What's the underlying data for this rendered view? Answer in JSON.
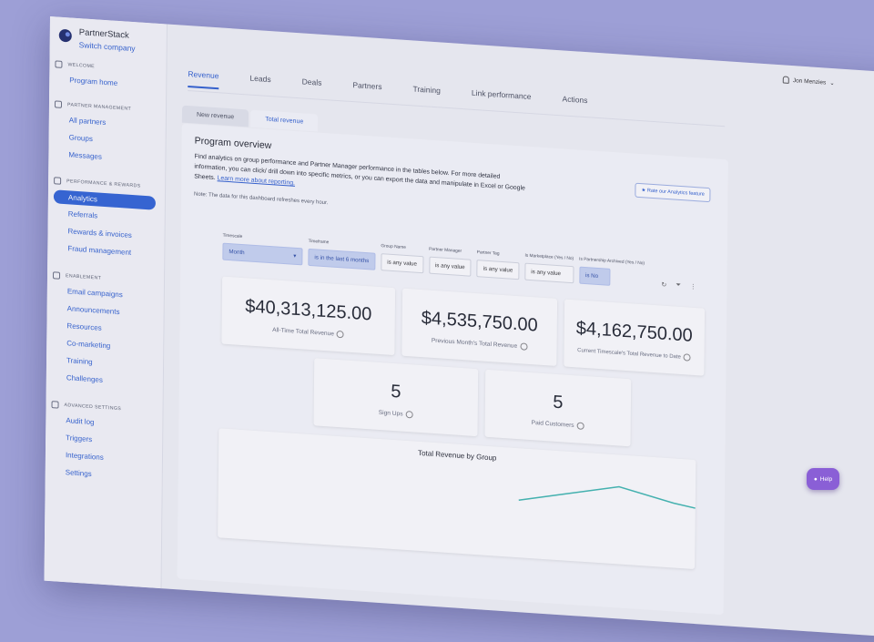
{
  "brand": {
    "name": "PartnerStack",
    "switch_label": "Switch company"
  },
  "user": {
    "name": "Jon Menzies"
  },
  "sidebar": {
    "sections": [
      {
        "title": "WELCOME",
        "items": [
          "Program home"
        ]
      },
      {
        "title": "PARTNER MANAGEMENT",
        "items": [
          "All partners",
          "Groups",
          "Messages"
        ]
      },
      {
        "title": "PERFORMANCE & REWARDS",
        "items": [
          "Analytics",
          "Referrals",
          "Rewards & invoices",
          "Fraud management"
        ]
      },
      {
        "title": "ENABLEMENT",
        "items": [
          "Email campaigns",
          "Announcements",
          "Resources",
          "Co-marketing",
          "Training",
          "Challenges"
        ]
      },
      {
        "title": "ADVANCED SETTINGS",
        "items": [
          "Audit log",
          "Triggers",
          "Integrations",
          "Settings"
        ]
      }
    ],
    "active_item": "Analytics"
  },
  "tabs": [
    "Revenue",
    "Leads",
    "Deals",
    "Partners",
    "Training",
    "Link performance",
    "Actions"
  ],
  "active_tab": "Revenue",
  "subtabs": [
    "New revenue",
    "Total revenue"
  ],
  "active_subtab": "Total revenue",
  "panel": {
    "title": "Program overview",
    "desc": "Find analytics on group performance and Partner Manager performance in the tables below. For more detailed information, you can click/ drill down into specific metrics, or you can export the data and manipulate in Excel or Google Sheets.",
    "link": "Learn more about reporting.",
    "note": "Note: The data for this dashboard refreshes every hour.",
    "rate_button": "★ Rate our Analytics feature"
  },
  "filters": [
    {
      "label": "Timescale",
      "value": "Month"
    },
    {
      "label": "Timeframe",
      "value": "is in the last 6 months"
    },
    {
      "label": "Group Name",
      "value": "is any value"
    },
    {
      "label": "Partner Manager",
      "value": "is any value"
    },
    {
      "label": "Partner Tag",
      "value": "is any value"
    },
    {
      "label": "Is Marketplace (Yes / No)",
      "value": "is any value"
    },
    {
      "label": "Is Partnership Archived (Yes / No)",
      "value": "is No"
    }
  ],
  "kpis": [
    {
      "value": "$40,313,125.00",
      "label": "All-Time Total Revenue"
    },
    {
      "value": "$4,535,750.00",
      "label": "Previous Month's Total Revenue"
    },
    {
      "value": "$4,162,750.00",
      "label": "Current Timescale's Total Revenue to Date"
    },
    {
      "value": "5",
      "label": "Sign Ups"
    },
    {
      "value": "5",
      "label": "Paid Customers"
    }
  ],
  "chart": {
    "title": "Total Revenue by Group",
    "line_color": "#3fb8b0"
  },
  "help_label": "Help"
}
